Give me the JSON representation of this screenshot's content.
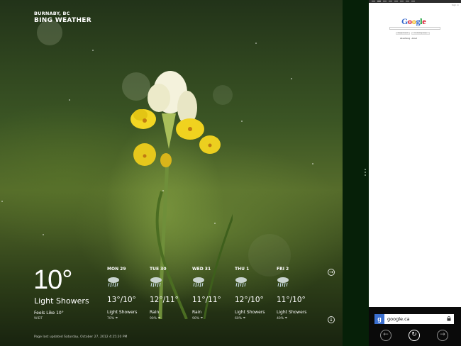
{
  "weather": {
    "location": "BURNABY, BC",
    "app_title": "BING WEATHER",
    "current": {
      "temp": "10°",
      "condition": "Light Showers",
      "feels_like": "Feels Like 10°",
      "wind": "WIDT"
    },
    "forecast": [
      {
        "day": "MON 29",
        "temps": "13°/10°",
        "condition": "Light Showers",
        "precip": "70% ☂",
        "icon": "rain-icon"
      },
      {
        "day": "TUE 30",
        "temps": "12°/11°",
        "condition": "Rain",
        "precip": "90% ☂",
        "icon": "rain-icon"
      },
      {
        "day": "WED 31",
        "temps": "11°/11°",
        "condition": "Rain",
        "precip": "90% ☂",
        "icon": "rain-icon"
      },
      {
        "day": "THU 1",
        "temps": "12°/10°",
        "condition": "Light Showers",
        "precip": "60% ☂",
        "icon": "rain-icon"
      },
      {
        "day": "FRI 2",
        "temps": "11°/10°",
        "condition": "Light Showers",
        "precip": "40% ☂",
        "icon": "rain-icon"
      }
    ],
    "updated": "Page last updated Saturday, October 27, 2012 4:25:20 PM",
    "next_icon": "→",
    "down_icon": "↓"
  },
  "browser": {
    "logo": "Google",
    "search_button": "Google Search",
    "lucky_button": "I'm Feeling Lucky",
    "links": "Advertising · About",
    "sign_in": "Sign in",
    "url": "google.ca",
    "back_icon": "←",
    "refresh_icon": "↻",
    "forward_icon": "→",
    "colors": {
      "g_blue": "#3366cc",
      "g_red": "#d50f25",
      "g_yellow": "#eeb211",
      "g_green": "#009925"
    }
  }
}
